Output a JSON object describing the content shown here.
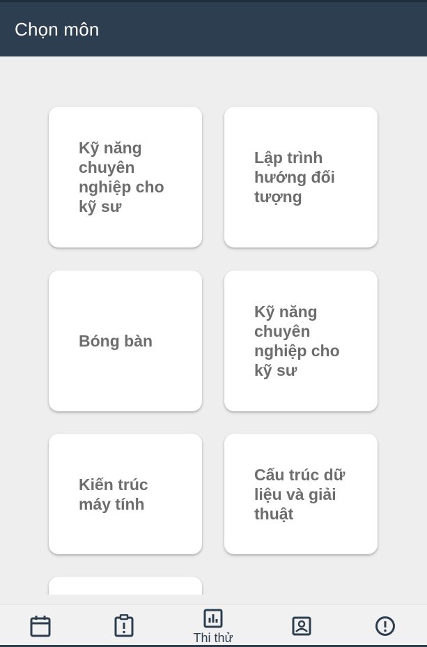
{
  "header": {
    "title": "Chọn môn"
  },
  "subjects": [
    {
      "label": "Kỹ năng chuyên nghiệp cho kỹ sư"
    },
    {
      "label": "Lập trình hướng đối tượng"
    },
    {
      "label": "Bóng bàn"
    },
    {
      "label": "Kỹ năng chuyên nghiệp cho kỹ sư"
    },
    {
      "label": "Kiến trúc máy tính"
    },
    {
      "label": "Cấu trúc dữ liệu và giải thuật"
    },
    {
      "label": ""
    }
  ],
  "bottom_nav": {
    "items": [
      {
        "icon": "calendar-icon",
        "label": ""
      },
      {
        "icon": "clipboard-alert-icon",
        "label": ""
      },
      {
        "icon": "bar-chart-icon",
        "label": "Thi thử",
        "active": true
      },
      {
        "icon": "contact-card-icon",
        "label": ""
      },
      {
        "icon": "info-circle-icon",
        "label": ""
      }
    ]
  },
  "colors": {
    "header_bg": "#2d3e50",
    "page_bg": "#eeeeee",
    "card_bg": "#ffffff",
    "card_text": "#6d6d6d",
    "nav_icon": "#2d3e50"
  }
}
